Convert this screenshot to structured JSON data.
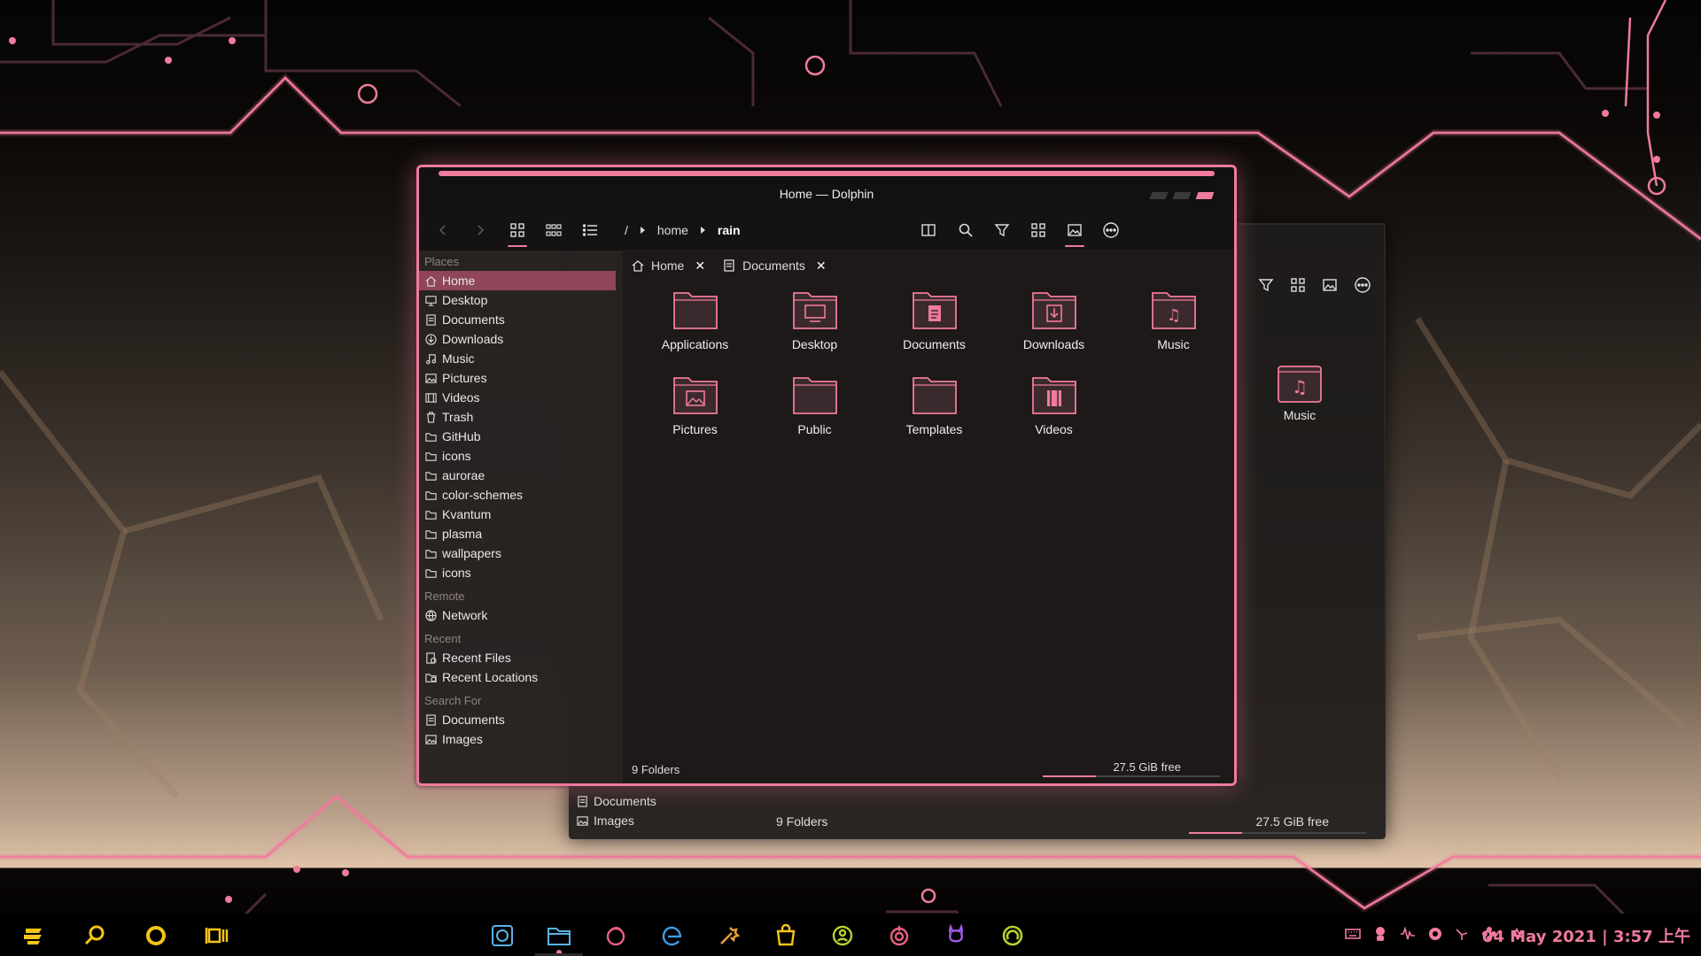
{
  "colors": {
    "accent": "#f07b9c",
    "selection": "#8e4658",
    "taskbar_yellow": "#f5c518"
  },
  "window": {
    "title": "Home — Dolphin"
  },
  "breadcrumb": {
    "root": "/",
    "parts": [
      "home",
      "rain"
    ]
  },
  "sidebar": {
    "places_title": "Places",
    "places": [
      {
        "label": "Home",
        "icon": "home-icon"
      },
      {
        "label": "Desktop",
        "icon": "desktop-icon"
      },
      {
        "label": "Documents",
        "icon": "documents-icon"
      },
      {
        "label": "Downloads",
        "icon": "downloads-icon"
      },
      {
        "label": "Music",
        "icon": "music-icon"
      },
      {
        "label": "Pictures",
        "icon": "pictures-icon"
      },
      {
        "label": "Videos",
        "icon": "videos-icon"
      },
      {
        "label": "Trash",
        "icon": "trash-icon"
      },
      {
        "label": "GitHub",
        "icon": "folder-icon"
      },
      {
        "label": "icons",
        "icon": "folder-icon"
      },
      {
        "label": "aurorae",
        "icon": "folder-icon"
      },
      {
        "label": "color-schemes",
        "icon": "folder-icon"
      },
      {
        "label": "Kvantum",
        "icon": "folder-icon"
      },
      {
        "label": "plasma",
        "icon": "folder-icon"
      },
      {
        "label": "wallpapers",
        "icon": "folder-icon"
      },
      {
        "label": "icons",
        "icon": "folder-icon"
      }
    ],
    "remote_title": "Remote",
    "remote": [
      {
        "label": "Network",
        "icon": "network-icon"
      }
    ],
    "recent_title": "Recent",
    "recent": [
      {
        "label": "Recent Files",
        "icon": "recent-files-icon"
      },
      {
        "label": "Recent Locations",
        "icon": "recent-locations-icon"
      }
    ],
    "search_title": "Search For",
    "search": [
      {
        "label": "Documents",
        "icon": "documents-icon"
      },
      {
        "label": "Images",
        "icon": "pictures-icon"
      }
    ]
  },
  "tabs": [
    {
      "label": "Home",
      "icon": "home-icon"
    },
    {
      "label": "Documents",
      "icon": "documents-icon"
    }
  ],
  "folders": [
    {
      "label": "Applications",
      "glyph": ""
    },
    {
      "label": "Desktop",
      "glyph": "desktop"
    },
    {
      "label": "Documents",
      "glyph": "doc"
    },
    {
      "label": "Downloads",
      "glyph": "down"
    },
    {
      "label": "Music",
      "glyph": "♫"
    },
    {
      "label": "Pictures",
      "glyph": "pic"
    },
    {
      "label": "Public",
      "glyph": ""
    },
    {
      "label": "Templates",
      "glyph": ""
    },
    {
      "label": "Videos",
      "glyph": "vid"
    }
  ],
  "status": {
    "count": "9 Folders",
    "free": "27.5 GiB free",
    "free_fraction": 0.3
  },
  "back_window": {
    "music_label": "Music",
    "places": [
      {
        "label": "Documents"
      },
      {
        "label": "Images"
      }
    ],
    "count": "9 Folders",
    "free": "27.5 GiB free"
  },
  "taskbar": {
    "clock": "04 May 2021 | 3:57 上午"
  }
}
